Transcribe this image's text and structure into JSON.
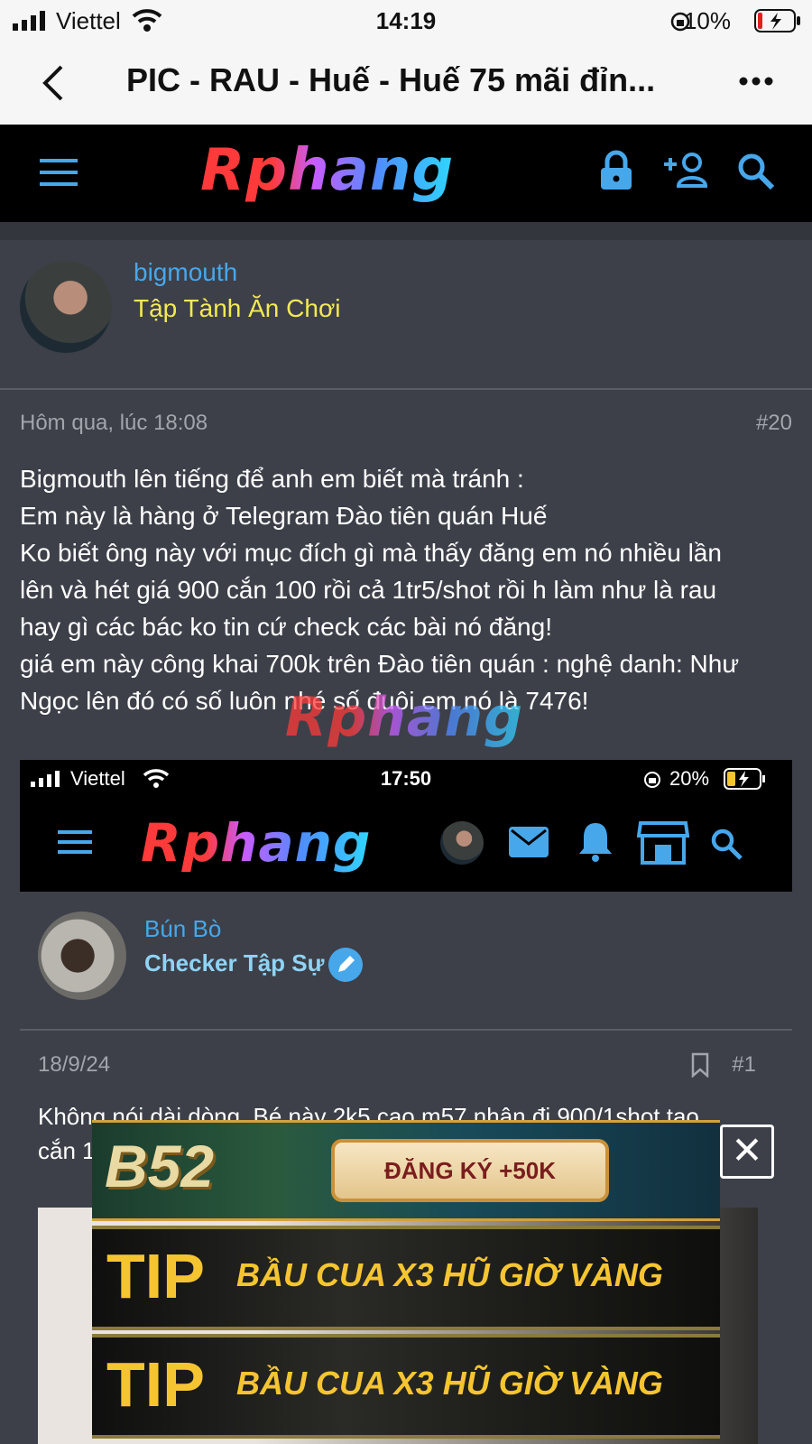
{
  "status_bar": {
    "carrier": "Viettel",
    "time": "14:19",
    "battery": "10%"
  },
  "browser": {
    "title": "PIC - RAU - Huế - Huế 75 mãi đỉn..."
  },
  "site": {
    "logo": "Rphang"
  },
  "author": {
    "username": "bigmouth",
    "user_title": "Tập Tành Ăn Chơi"
  },
  "post": {
    "timestamp": "Hôm qua, lúc 18:08",
    "number": "#20",
    "body": [
      "Bigmouth lên tiếng để anh em biết mà tránh :",
      "Em này là hàng ở Telegram Đào tiên quán Huế",
      "Ko biết ông này với mục đích gì mà thấy đăng em nó nhiều lần",
      "lên và hét giá 900 cắn 100 rồi cả 1tr5/shot rồi h làm như là rau",
      "hay gì các bác ko tin cứ check các bài nó đăng!",
      "giá em này công khai 700k trên Đào tiên quán : nghệ danh: Như",
      "Ngọc lên đó có số luôn nhé số đuôi em nó là 7476!"
    ]
  },
  "watermark": "Rphang",
  "embed": {
    "status_bar": {
      "carrier": "Viettel",
      "time": "17:50",
      "battery": "20%"
    },
    "logo": "Rphang",
    "author": {
      "username": "Bún Bò",
      "user_title": "Checker Tập Sự"
    },
    "post": {
      "date": "18/9/24",
      "number": "#1",
      "text_line1": "Không nói dài dòng. Bé này 2k5 cao m57 nhận đi 900/1shot tao",
      "text_line2": "cắn 1"
    }
  },
  "ads": {
    "b52": {
      "brand": "B52",
      "cta": "ĐĂNG KÝ +50K"
    },
    "tip1": {
      "brand": "TIP",
      "slogan": "BẦU CUA X3 HŨ GIỜ VÀNG"
    },
    "tip2": {
      "brand": "TIP",
      "slogan": "BẦU CUA X3 HŨ GIỜ VÀNG"
    },
    "close": "✕"
  }
}
